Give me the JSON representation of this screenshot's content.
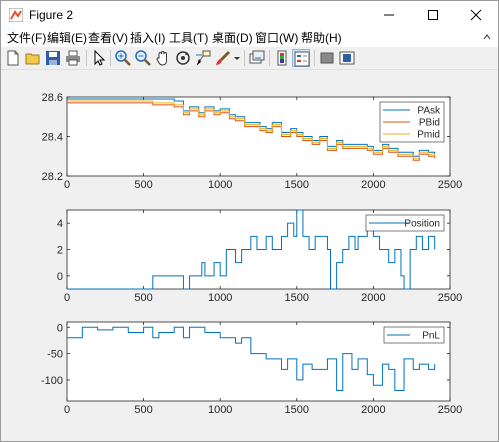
{
  "window": {
    "title": "Figure 2"
  },
  "menu": [
    "文件(F)",
    "编辑(E)",
    "查看(V)",
    "插入(I)",
    "工具(T)",
    "桌面(D)",
    "窗口(W)",
    "帮助(H)"
  ],
  "toolbar_icons": [
    "new-figure-icon",
    "open-file-icon",
    "save-icon",
    "print-icon",
    "edit-plot-arrow-icon",
    "zoom-in-icon",
    "zoom-out-icon",
    "pan-hand-icon",
    "rotate-3d-icon",
    "data-cursor-icon",
    "brush-icon",
    "brush-dropdown-icon",
    "link-plot-icon",
    "insert-colorbar-icon",
    "insert-legend-icon",
    "hide-plot-tools-icon",
    "show-plot-tools-icon"
  ],
  "colors": {
    "pask": "#0072bd",
    "pbid": "#d95319",
    "pmid": "#edb120",
    "position": "#0072bd",
    "pnl": "#0072bd"
  },
  "chart_data": [
    {
      "type": "line",
      "title": "",
      "xlim": [
        0,
        2500
      ],
      "ylim": [
        28.2,
        28.6
      ],
      "xticks": [
        "0",
        "500",
        "1000",
        "1500",
        "2000",
        "2500"
      ],
      "yticks": [
        "28.2",
        "28.4",
        "28.6"
      ],
      "legend": {
        "placement": "top-right",
        "entries": [
          "PAsk",
          "PBid",
          "Pmid"
        ]
      },
      "series": [
        {
          "name": "PAsk",
          "x": [
            0,
            200,
            400,
            560,
            700,
            760,
            800,
            860,
            900,
            960,
            1000,
            1060,
            1100,
            1160,
            1200,
            1260,
            1300,
            1340,
            1400,
            1460,
            1500,
            1540,
            1600,
            1650,
            1700,
            1760,
            1800,
            1860,
            1900,
            1960,
            2000,
            2060,
            2100,
            2160,
            2200,
            2260,
            2300,
            2360,
            2400
          ],
          "values": [
            28.59,
            28.59,
            28.59,
            28.59,
            28.58,
            28.53,
            28.55,
            28.52,
            28.55,
            28.53,
            28.54,
            28.51,
            28.5,
            28.47,
            28.47,
            28.45,
            28.44,
            28.47,
            28.42,
            28.44,
            28.42,
            28.4,
            28.38,
            28.4,
            28.35,
            28.38,
            28.36,
            28.36,
            28.36,
            28.35,
            28.33,
            28.36,
            28.34,
            28.32,
            28.32,
            28.3,
            28.33,
            28.32,
            28.31
          ]
        },
        {
          "name": "PBid",
          "x": [
            0,
            200,
            400,
            560,
            700,
            760,
            800,
            860,
            900,
            960,
            1000,
            1060,
            1100,
            1160,
            1200,
            1260,
            1300,
            1340,
            1400,
            1460,
            1500,
            1540,
            1600,
            1650,
            1700,
            1760,
            1800,
            1860,
            1900,
            1960,
            2000,
            2060,
            2100,
            2160,
            2200,
            2260,
            2300,
            2360,
            2400
          ],
          "values": [
            28.57,
            28.57,
            28.57,
            28.56,
            28.55,
            28.51,
            28.53,
            28.5,
            28.53,
            28.51,
            28.52,
            28.49,
            28.48,
            28.45,
            28.45,
            28.43,
            28.42,
            28.45,
            28.4,
            28.42,
            28.4,
            28.38,
            28.36,
            28.38,
            28.33,
            28.36,
            28.34,
            28.34,
            28.34,
            28.33,
            28.31,
            28.34,
            28.32,
            28.3,
            28.3,
            28.28,
            28.31,
            28.3,
            28.29
          ]
        },
        {
          "name": "Pmid",
          "x": [
            0,
            200,
            400,
            560,
            700,
            760,
            800,
            860,
            900,
            960,
            1000,
            1060,
            1100,
            1160,
            1200,
            1260,
            1300,
            1340,
            1400,
            1460,
            1500,
            1540,
            1600,
            1650,
            1700,
            1760,
            1800,
            1860,
            1900,
            1960,
            2000,
            2060,
            2100,
            2160,
            2200,
            2260,
            2300,
            2360,
            2400
          ],
          "values": [
            28.58,
            28.58,
            28.58,
            28.57,
            28.56,
            28.52,
            28.54,
            28.51,
            28.54,
            28.52,
            28.53,
            28.5,
            28.49,
            28.46,
            28.46,
            28.44,
            28.43,
            28.46,
            28.41,
            28.43,
            28.41,
            28.39,
            28.37,
            28.39,
            28.34,
            28.37,
            28.35,
            28.35,
            28.35,
            28.34,
            28.32,
            28.35,
            28.33,
            28.31,
            28.31,
            28.29,
            28.32,
            28.31,
            28.3
          ]
        }
      ]
    },
    {
      "type": "line",
      "title": "",
      "xlim": [
        0,
        2500
      ],
      "ylim": [
        -1,
        5
      ],
      "xticks": [
        "0",
        "500",
        "1000",
        "1500",
        "2000",
        "2500"
      ],
      "yticks": [
        "0",
        "2",
        "4"
      ],
      "legend": {
        "placement": "top-right",
        "entries": [
          "Position"
        ]
      },
      "series": [
        {
          "name": "Position",
          "x": [
            0,
            540,
            560,
            700,
            760,
            800,
            880,
            900,
            960,
            1000,
            1040,
            1100,
            1140,
            1200,
            1240,
            1300,
            1340,
            1400,
            1440,
            1480,
            1500,
            1540,
            1580,
            1620,
            1700,
            1720,
            1760,
            1800,
            1840,
            1880,
            1900,
            1960,
            2000,
            2040,
            2100,
            2140,
            2180,
            2200,
            2240,
            2280,
            2320,
            2360,
            2400
          ],
          "values": [
            -1,
            -1,
            0,
            0,
            -1,
            0,
            1,
            0,
            1,
            0,
            2,
            1,
            2,
            3,
            2,
            3,
            2,
            3,
            4,
            3,
            5,
            3,
            2,
            3,
            2,
            -1,
            1,
            2,
            3,
            2,
            3,
            4,
            3,
            2,
            1,
            2,
            0,
            -1,
            2,
            3,
            2,
            3,
            2
          ]
        }
      ]
    },
    {
      "type": "line",
      "title": "",
      "xlim": [
        0,
        2500
      ],
      "ylim": [
        -140,
        10
      ],
      "xticks": [
        "0",
        "500",
        "1000",
        "1500",
        "2000",
        "2500"
      ],
      "yticks": [
        "0",
        "-50",
        "-100"
      ],
      "legend": {
        "placement": "top-right",
        "entries": [
          "PnL"
        ]
      },
      "series": [
        {
          "name": "PnL",
          "x": [
            0,
            100,
            200,
            300,
            400,
            500,
            560,
            600,
            700,
            760,
            800,
            900,
            1000,
            1100,
            1140,
            1200,
            1300,
            1400,
            1440,
            1500,
            1540,
            1600,
            1700,
            1760,
            1800,
            1860,
            1900,
            1960,
            2000,
            2060,
            2100,
            2140,
            2200,
            2260,
            2300,
            2360,
            2400
          ],
          "values": [
            -20,
            0,
            -5,
            0,
            -10,
            0,
            -20,
            -10,
            0,
            -20,
            0,
            -10,
            -20,
            -30,
            -20,
            -50,
            -60,
            -80,
            -60,
            -100,
            -70,
            -80,
            -60,
            -120,
            -50,
            -80,
            -60,
            -90,
            -110,
            -70,
            -80,
            -120,
            -60,
            -80,
            -70,
            -80,
            -70
          ]
        }
      ]
    }
  ]
}
